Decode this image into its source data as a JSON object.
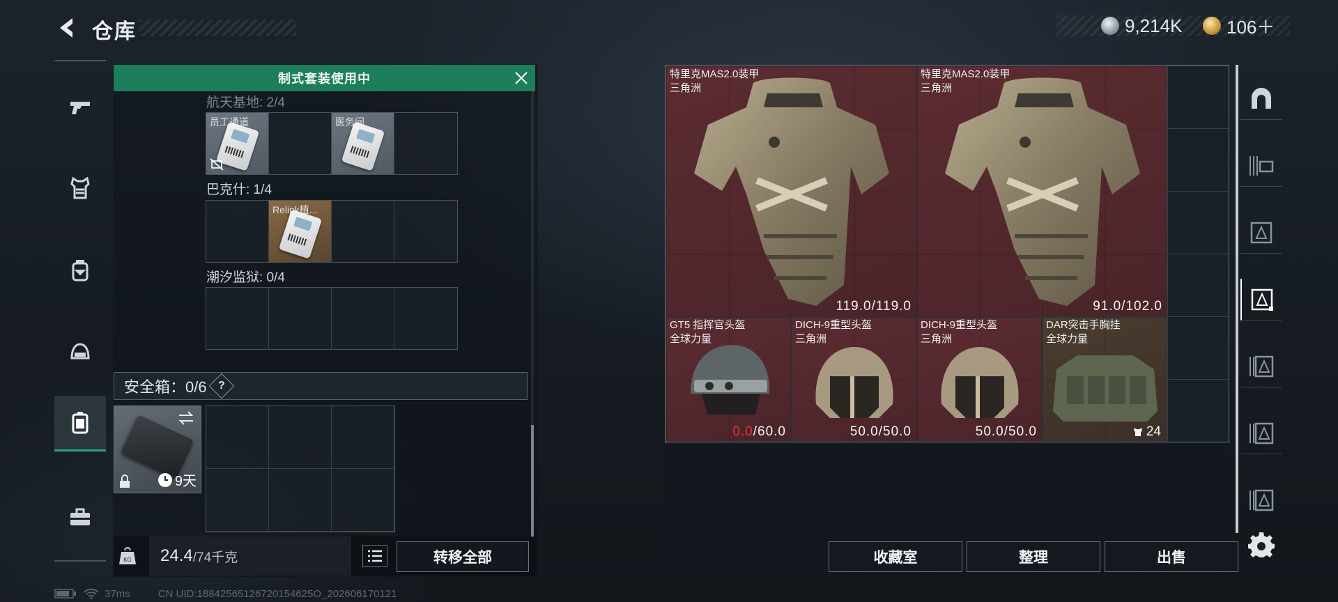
{
  "header": {
    "title": "仓库",
    "currency_silver": "9,214K",
    "currency_gold": "106＋"
  },
  "left_nav": {
    "items": [
      {
        "name": "weapons",
        "icon": "pistol-icon"
      },
      {
        "name": "armor",
        "icon": "vest-icon"
      },
      {
        "name": "backpack",
        "icon": "backpack-icon"
      },
      {
        "name": "helmet",
        "icon": "helmet-icon"
      },
      {
        "name": "keys",
        "icon": "keycard-case-icon",
        "active": true
      },
      {
        "name": "toolbox",
        "icon": "toolbox-icon"
      }
    ]
  },
  "left_panel": {
    "banner": "制式套装使用中",
    "groups": [
      {
        "label": "航天基地: 2/4",
        "slots": [
          {
            "label": "员工通道",
            "filled": true,
            "disabled_icon": true
          },
          {
            "label": "",
            "filled": false
          },
          {
            "label": "医务间",
            "filled": true
          },
          {
            "label": "",
            "filled": false
          }
        ]
      },
      {
        "label": "巴克什: 1/4",
        "slots": [
          {
            "label": "",
            "filled": false
          },
          {
            "label": "Relink植...",
            "filled": true,
            "orange": true
          },
          {
            "label": "",
            "filled": false
          },
          {
            "label": "",
            "filled": false
          }
        ]
      },
      {
        "label": "潮汐监狱: 0/4",
        "slots": [
          {
            "label": "",
            "filled": false
          },
          {
            "label": "",
            "filled": false
          },
          {
            "label": "",
            "filled": false
          },
          {
            "label": "",
            "filled": false
          }
        ]
      }
    ],
    "safebox": {
      "label": "安全箱：0/6",
      "help": "?",
      "timer": "9天"
    },
    "weight_current": "24.4",
    "weight_max": "/74千克",
    "transfer_all": "转移全部"
  },
  "status": {
    "ping": "37ms",
    "uid": "CN UID:18842565126720154625O_202606170121"
  },
  "storage_items": [
    {
      "name": "特里克MAS2.0装甲",
      "sub": "三角洲",
      "durability": "119.0/119.0",
      "color": "red",
      "art": "armor-vest"
    },
    {
      "name": "特里克MAS2.0装甲",
      "sub": "三角洲",
      "durability": "91.0/102.0",
      "color": "red",
      "art": "armor-vest"
    },
    {
      "name": "GT5 指挥官头盔",
      "sub": "全球力量",
      "durability_low": "0.0",
      "durability_rest": "/60.0",
      "color": "red",
      "art": "helmet-tactical"
    },
    {
      "name": "DICH-9重型头盔",
      "sub": "三角洲",
      "durability": "50.0/50.0",
      "color": "red",
      "art": "helmet-heavy"
    },
    {
      "name": "DICH-9重型头盔",
      "sub": "三角洲",
      "durability": "50.0/50.0",
      "color": "red",
      "art": "helmet-heavy"
    },
    {
      "name": "DAR突击手胸挂",
      "sub": "全球力量",
      "count": "24",
      "color": "tan",
      "art": "chest-rig"
    }
  ],
  "footer_buttons": {
    "collection": "收藏室",
    "organize": "整理",
    "sell": "出售"
  },
  "right_nav": {
    "items": [
      "arch-icon",
      "container-1-icon",
      "container-2-icon",
      "container-3-icon",
      "container-4-icon",
      "container-5-icon",
      "container-6-icon"
    ]
  }
}
